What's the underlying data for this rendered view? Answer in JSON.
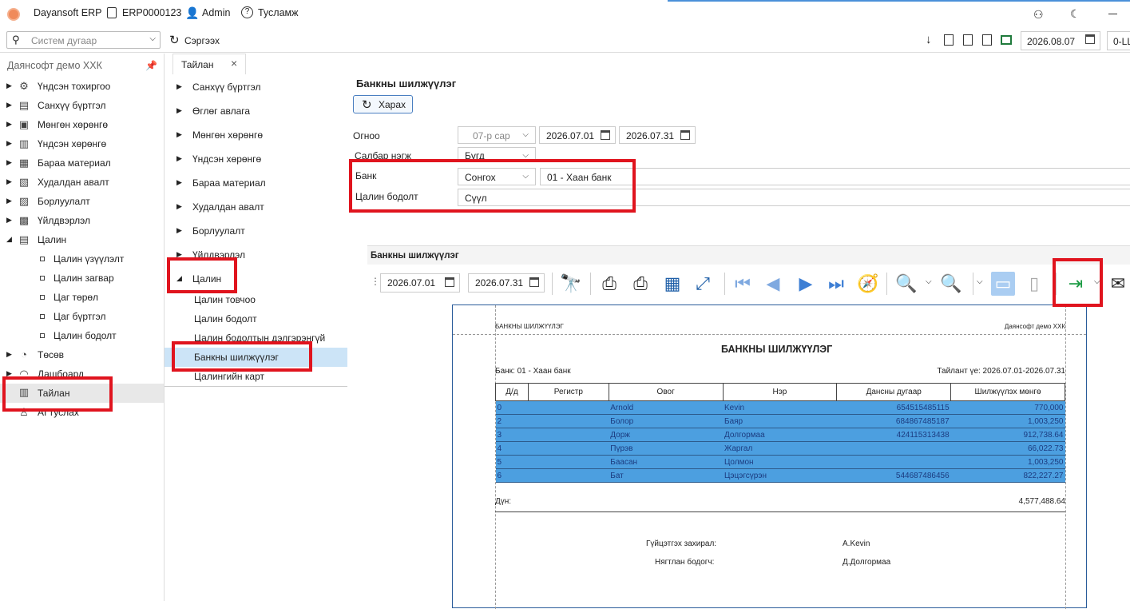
{
  "titlebar": {
    "app_name": "Dayansoft ERP",
    "code": "ERP0000123",
    "user": "Admin",
    "help": "Тусламж"
  },
  "toolbar": {
    "search_placeholder": "Систем дугаар",
    "refresh": "Сэргээх",
    "date": "2026.08.07",
    "right_field": "0-LL"
  },
  "sidebar": {
    "company": "Даянсофт демо ХХК",
    "items": [
      {
        "label": "Үндсэн тохиргоо",
        "icon": "gear-icon"
      },
      {
        "label": "Санхүү бүртгэл",
        "icon": "ledger-icon"
      },
      {
        "label": "Мөнгөн хөрөнгө",
        "icon": "money-icon"
      },
      {
        "label": "Үндсэн хөрөнгө",
        "icon": "building-icon"
      },
      {
        "label": "Бараа материал",
        "icon": "box-icon"
      },
      {
        "label": "Худалдан авалт",
        "icon": "cart-icon"
      },
      {
        "label": "Борлуулалт",
        "icon": "sales-icon"
      },
      {
        "label": "Үйлдвэрлэл",
        "icon": "factory-icon"
      },
      {
        "label": "Цалин",
        "icon": "payroll-icon"
      }
    ],
    "sub_items": [
      "Цалин үзүүлэлт",
      "Цалин загвар",
      "Цаг төрөл",
      "Цаг бүртгэл",
      "Цалин бодолт"
    ],
    "bottom_items": [
      {
        "label": "Төсөв",
        "icon": "pie-chart-icon"
      },
      {
        "label": "Дашбоард",
        "icon": "dashboard-icon"
      },
      {
        "label": "Тайлан",
        "icon": "report-icon"
      },
      {
        "label": "AI туслах",
        "icon": "ai-assistant-icon"
      }
    ]
  },
  "tab": {
    "label": "Тайлан"
  },
  "middle": {
    "items": [
      "Санхүү бүртгэл",
      "Өглөг авлага",
      "Мөнгөн хөрөнгө",
      "Үндсэн хөрөнгө",
      "Бараа материал",
      "Худалдан авалт",
      "Борлуулалт",
      "Үйлдвэрлэл"
    ],
    "open_item": "Цалин",
    "sub_items": [
      "Цалин товчоо",
      "Цалин бодолт",
      "Цалин бодолтын дэлгэрэнгүй",
      "Банкны шилжүүлэг",
      "Цалингийн карт"
    ]
  },
  "form": {
    "title": "Банкны шилжүүлэг",
    "view_button": "Харах",
    "period_label": "Огноо",
    "month": "07-р сар",
    "date_from": "2026.07.01",
    "date_to": "2026.07.31",
    "branch_label": "Салбар нэгж",
    "branch_value": "Бүгд",
    "bank_label": "Банк",
    "bank_select": "Сонгох",
    "bank_value": "01 - Хаан банк",
    "calc_label": "Цалин бодолт",
    "calc_value": "Сүүл"
  },
  "report_panel": {
    "title": "Банкны шилжүүлэг",
    "date_from": "2026.07.01",
    "date_to": "2026.07.31"
  },
  "report": {
    "header_left": "БАНКНЫ ШИЛЖҮҮЛЭГ",
    "header_right": "Даянсофт демо ХХК",
    "title": "БАНКНЫ ШИЛЖҮҮЛЭГ",
    "bank_line": "Банк: 01 - Хаан банк",
    "period_line": "Тайлант үе: 2026.07.01-2026.07.31",
    "columns": [
      "Д/д",
      "Регистр",
      "Овог",
      "Нэр",
      "Дансны дугаар",
      "Шилжүүлэх мөнгө"
    ],
    "rows": [
      [
        "0",
        "",
        "Arnold",
        "Kevin",
        "654515485115",
        "770,000"
      ],
      [
        "2",
        "",
        "Болор",
        "Баяр",
        "684867485187",
        "1,003,250"
      ],
      [
        "3",
        "",
        "Дорж",
        "Долгормаа",
        "424115313438",
        "912,738.64"
      ],
      [
        "4",
        "",
        "Пүрэв",
        "Жаргал",
        "",
        "66,022.73"
      ],
      [
        "5",
        "",
        "Баасан",
        "Цолмон",
        "",
        "1,003,250"
      ],
      [
        "6",
        "",
        "Бат",
        "Цэцэгсүрэн",
        "544687486456",
        "822,227.27"
      ]
    ],
    "total_label": "Дүн:",
    "total_value": "4,577,488.64",
    "sign1_label": "Гүйцэтгэх захирал:",
    "sign1_name": "A.Kevin",
    "sign2_label": "Нягтлан бодогч:",
    "sign2_name": "Д.Долгормаа"
  }
}
